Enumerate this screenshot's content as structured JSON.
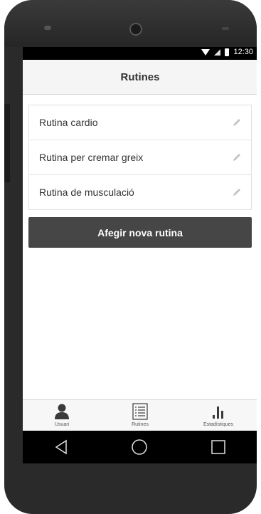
{
  "status_bar": {
    "time": "12:30"
  },
  "header": {
    "title": "Rutines"
  },
  "routines": [
    {
      "label": "Rutina cardio"
    },
    {
      "label": "Rutina per cremar greix"
    },
    {
      "label": "Rutina de musculació"
    }
  ],
  "add_button": {
    "label": "Afegir nova rutina"
  },
  "bottom_nav": [
    {
      "label": "Usuari",
      "icon": "user-icon"
    },
    {
      "label": "Rutines",
      "icon": "list-icon"
    },
    {
      "label": "Estadístiques",
      "icon": "bar-chart-icon"
    }
  ],
  "colors": {
    "button_bg": "#464646",
    "header_bg": "#f5f5f5",
    "status_bar_bg": "#000000"
  }
}
